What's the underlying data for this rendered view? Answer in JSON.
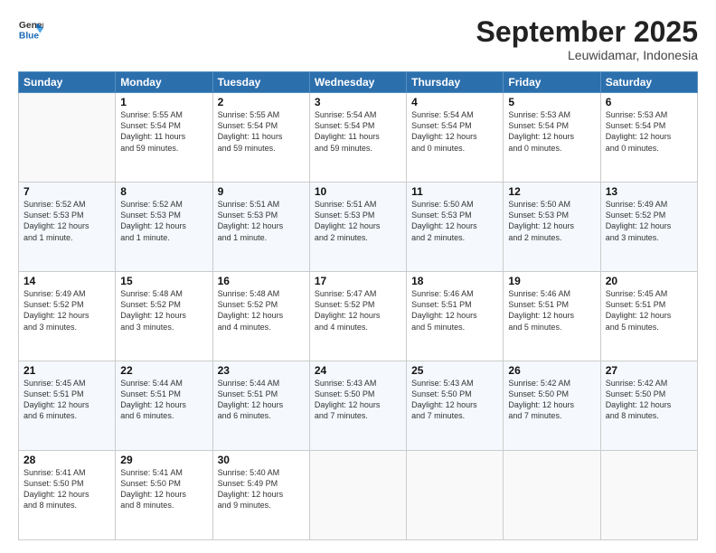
{
  "header": {
    "logo_line1": "General",
    "logo_line2": "Blue",
    "month": "September 2025",
    "location": "Leuwidamar, Indonesia"
  },
  "weekdays": [
    "Sunday",
    "Monday",
    "Tuesday",
    "Wednesday",
    "Thursday",
    "Friday",
    "Saturday"
  ],
  "weeks": [
    [
      {
        "day": "",
        "info": ""
      },
      {
        "day": "1",
        "info": "Sunrise: 5:55 AM\nSunset: 5:54 PM\nDaylight: 11 hours\nand 59 minutes."
      },
      {
        "day": "2",
        "info": "Sunrise: 5:55 AM\nSunset: 5:54 PM\nDaylight: 11 hours\nand 59 minutes."
      },
      {
        "day": "3",
        "info": "Sunrise: 5:54 AM\nSunset: 5:54 PM\nDaylight: 11 hours\nand 59 minutes."
      },
      {
        "day": "4",
        "info": "Sunrise: 5:54 AM\nSunset: 5:54 PM\nDaylight: 12 hours\nand 0 minutes."
      },
      {
        "day": "5",
        "info": "Sunrise: 5:53 AM\nSunset: 5:54 PM\nDaylight: 12 hours\nand 0 minutes."
      },
      {
        "day": "6",
        "info": "Sunrise: 5:53 AM\nSunset: 5:54 PM\nDaylight: 12 hours\nand 0 minutes."
      }
    ],
    [
      {
        "day": "7",
        "info": "Sunrise: 5:52 AM\nSunset: 5:53 PM\nDaylight: 12 hours\nand 1 minute."
      },
      {
        "day": "8",
        "info": "Sunrise: 5:52 AM\nSunset: 5:53 PM\nDaylight: 12 hours\nand 1 minute."
      },
      {
        "day": "9",
        "info": "Sunrise: 5:51 AM\nSunset: 5:53 PM\nDaylight: 12 hours\nand 1 minute."
      },
      {
        "day": "10",
        "info": "Sunrise: 5:51 AM\nSunset: 5:53 PM\nDaylight: 12 hours\nand 2 minutes."
      },
      {
        "day": "11",
        "info": "Sunrise: 5:50 AM\nSunset: 5:53 PM\nDaylight: 12 hours\nand 2 minutes."
      },
      {
        "day": "12",
        "info": "Sunrise: 5:50 AM\nSunset: 5:53 PM\nDaylight: 12 hours\nand 2 minutes."
      },
      {
        "day": "13",
        "info": "Sunrise: 5:49 AM\nSunset: 5:52 PM\nDaylight: 12 hours\nand 3 minutes."
      }
    ],
    [
      {
        "day": "14",
        "info": "Sunrise: 5:49 AM\nSunset: 5:52 PM\nDaylight: 12 hours\nand 3 minutes."
      },
      {
        "day": "15",
        "info": "Sunrise: 5:48 AM\nSunset: 5:52 PM\nDaylight: 12 hours\nand 3 minutes."
      },
      {
        "day": "16",
        "info": "Sunrise: 5:48 AM\nSunset: 5:52 PM\nDaylight: 12 hours\nand 4 minutes."
      },
      {
        "day": "17",
        "info": "Sunrise: 5:47 AM\nSunset: 5:52 PM\nDaylight: 12 hours\nand 4 minutes."
      },
      {
        "day": "18",
        "info": "Sunrise: 5:46 AM\nSunset: 5:51 PM\nDaylight: 12 hours\nand 5 minutes."
      },
      {
        "day": "19",
        "info": "Sunrise: 5:46 AM\nSunset: 5:51 PM\nDaylight: 12 hours\nand 5 minutes."
      },
      {
        "day": "20",
        "info": "Sunrise: 5:45 AM\nSunset: 5:51 PM\nDaylight: 12 hours\nand 5 minutes."
      }
    ],
    [
      {
        "day": "21",
        "info": "Sunrise: 5:45 AM\nSunset: 5:51 PM\nDaylight: 12 hours\nand 6 minutes."
      },
      {
        "day": "22",
        "info": "Sunrise: 5:44 AM\nSunset: 5:51 PM\nDaylight: 12 hours\nand 6 minutes."
      },
      {
        "day": "23",
        "info": "Sunrise: 5:44 AM\nSunset: 5:51 PM\nDaylight: 12 hours\nand 6 minutes."
      },
      {
        "day": "24",
        "info": "Sunrise: 5:43 AM\nSunset: 5:50 PM\nDaylight: 12 hours\nand 7 minutes."
      },
      {
        "day": "25",
        "info": "Sunrise: 5:43 AM\nSunset: 5:50 PM\nDaylight: 12 hours\nand 7 minutes."
      },
      {
        "day": "26",
        "info": "Sunrise: 5:42 AM\nSunset: 5:50 PM\nDaylight: 12 hours\nand 7 minutes."
      },
      {
        "day": "27",
        "info": "Sunrise: 5:42 AM\nSunset: 5:50 PM\nDaylight: 12 hours\nand 8 minutes."
      }
    ],
    [
      {
        "day": "28",
        "info": "Sunrise: 5:41 AM\nSunset: 5:50 PM\nDaylight: 12 hours\nand 8 minutes."
      },
      {
        "day": "29",
        "info": "Sunrise: 5:41 AM\nSunset: 5:50 PM\nDaylight: 12 hours\nand 8 minutes."
      },
      {
        "day": "30",
        "info": "Sunrise: 5:40 AM\nSunset: 5:49 PM\nDaylight: 12 hours\nand 9 minutes."
      },
      {
        "day": "",
        "info": ""
      },
      {
        "day": "",
        "info": ""
      },
      {
        "day": "",
        "info": ""
      },
      {
        "day": "",
        "info": ""
      }
    ]
  ]
}
